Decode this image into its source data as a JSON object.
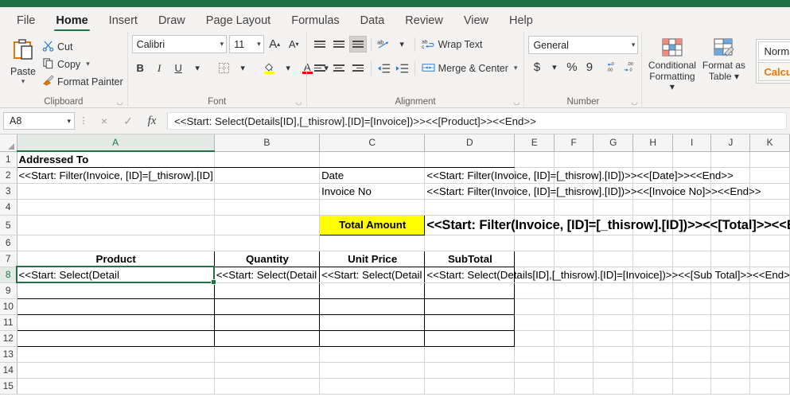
{
  "window": {
    "accent_color": "#217346"
  },
  "tabs": [
    {
      "label": "File",
      "active": false
    },
    {
      "label": "Home",
      "active": true
    },
    {
      "label": "Insert",
      "active": false
    },
    {
      "label": "Draw",
      "active": false
    },
    {
      "label": "Page Layout",
      "active": false
    },
    {
      "label": "Formulas",
      "active": false
    },
    {
      "label": "Data",
      "active": false
    },
    {
      "label": "Review",
      "active": false
    },
    {
      "label": "View",
      "active": false
    },
    {
      "label": "Help",
      "active": false
    }
  ],
  "ribbon": {
    "clipboard": {
      "group_label": "Clipboard",
      "paste_label": "Paste",
      "cut_label": "Cut",
      "copy_label": "Copy",
      "format_painter_label": "Format Painter"
    },
    "font": {
      "group_label": "Font",
      "font_name": "Calibri",
      "font_size": "11",
      "grow_font": "A",
      "shrink_font": "A",
      "bold": "B",
      "italic": "I",
      "underline": "U",
      "fill_color": "#ffff00",
      "font_color": "#ff0000"
    },
    "alignment": {
      "group_label": "Alignment",
      "wrap_text_label": "Wrap Text",
      "merge_center_label": "Merge & Center"
    },
    "number": {
      "group_label": "Number",
      "format_value": "General",
      "currency": "$",
      "percent": "%",
      "comma": "9",
      "increase_decimal": ".00",
      "decrease_decimal": ".00"
    },
    "styles": {
      "conditional_formatting_label": "Conditional\nFormatting",
      "conditional_formatting_line1": "Conditional",
      "conditional_formatting_line2": "Formatting",
      "format_as_table_line1": "Format as",
      "format_as_table_line2": "Table",
      "style_normal": "Normal",
      "style_calculation": "Calcul",
      "calculation_color": "#e8770a"
    }
  },
  "formula_bar": {
    "name_box": "A8",
    "cancel_icon": "×",
    "enter_icon": "✓",
    "function_icon": "fx",
    "formula": "<<Start: Select(Details[ID],[_thisrow].[ID]=[Invoice])>><<[Product]>><<End>>"
  },
  "grid": {
    "columns": [
      "A",
      "B",
      "C",
      "D",
      "E",
      "F",
      "G",
      "H",
      "I",
      "J",
      "K"
    ],
    "selected_column": "A",
    "selected_row": 8,
    "selected_cell": "A8",
    "rows": [
      "1",
      "2",
      "3",
      "4",
      "5",
      "6",
      "7",
      "8",
      "9",
      "10",
      "11",
      "12",
      "13",
      "14",
      "15"
    ],
    "cells": {
      "A1": "Addressed To",
      "A2": "<<Start: Filter(Invoice, [ID]=[_thisrow].[ID]",
      "A2_full": "<<Start: Filter(Invoice, [ID]=[_thisrow].[ID]",
      "C2": "Date",
      "D2": "<<Start: Filter(Invoice, [ID]=[_thisrow].[ID])>><<[Date]>><<End>>",
      "C3": "Invoice No",
      "D3": "<<Start: Filter(Invoice, [ID]=[_thisrow].[ID])>><<[Invoice No]>><<End>>",
      "C5": "Total Amount",
      "D5": "<<Start: Filter(Invoice, [ID]=[_thisrow].[ID])>><<[Total]>><<End>>",
      "A7": "Product",
      "B7": "Quantity",
      "C7": "Unit Price",
      "D7": "SubTotal",
      "A8": "<<Start: Select(Detail",
      "B8": "<<Start: Select(Detail",
      "C8": "<<Start: Select(Detail",
      "D8": "<<Start: Select(Details[ID],[_thisrow].[ID]=[Invoice])>><<[Sub Total]>><<End>>"
    }
  }
}
